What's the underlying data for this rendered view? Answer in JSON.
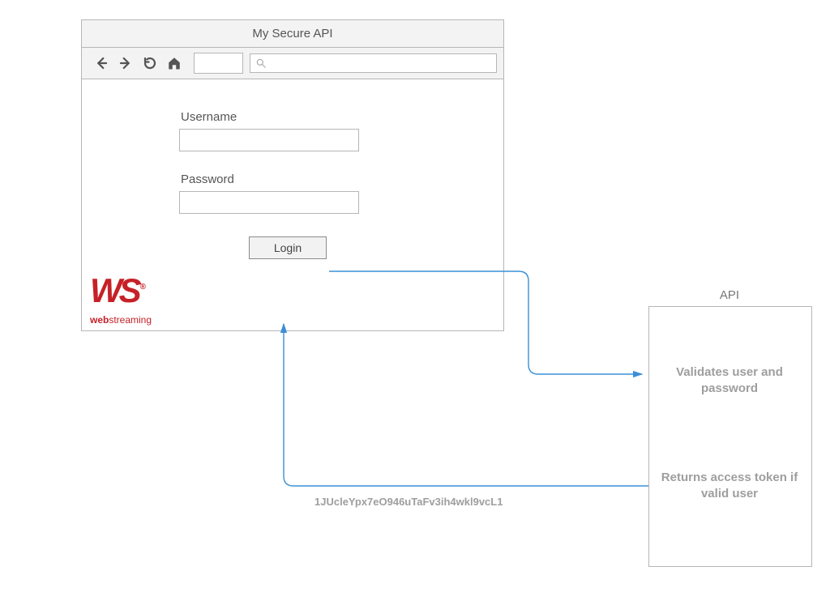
{
  "browser": {
    "title": "My Secure API"
  },
  "form": {
    "username_label": "Username",
    "password_label": "Password",
    "login_label": "Login"
  },
  "logo": {
    "mark": "WS",
    "reg": "®",
    "brand_bold": "web",
    "brand_rest": "streaming"
  },
  "api": {
    "title": "API",
    "validate_text": "Validates user and password",
    "return_text": "Returns access token if valid user"
  },
  "token": "1JUcleYpx7eO946uTaFv3ih4wkl9vcL1",
  "colors": {
    "brand": "#c62128",
    "flow": "#3a8fd6"
  }
}
